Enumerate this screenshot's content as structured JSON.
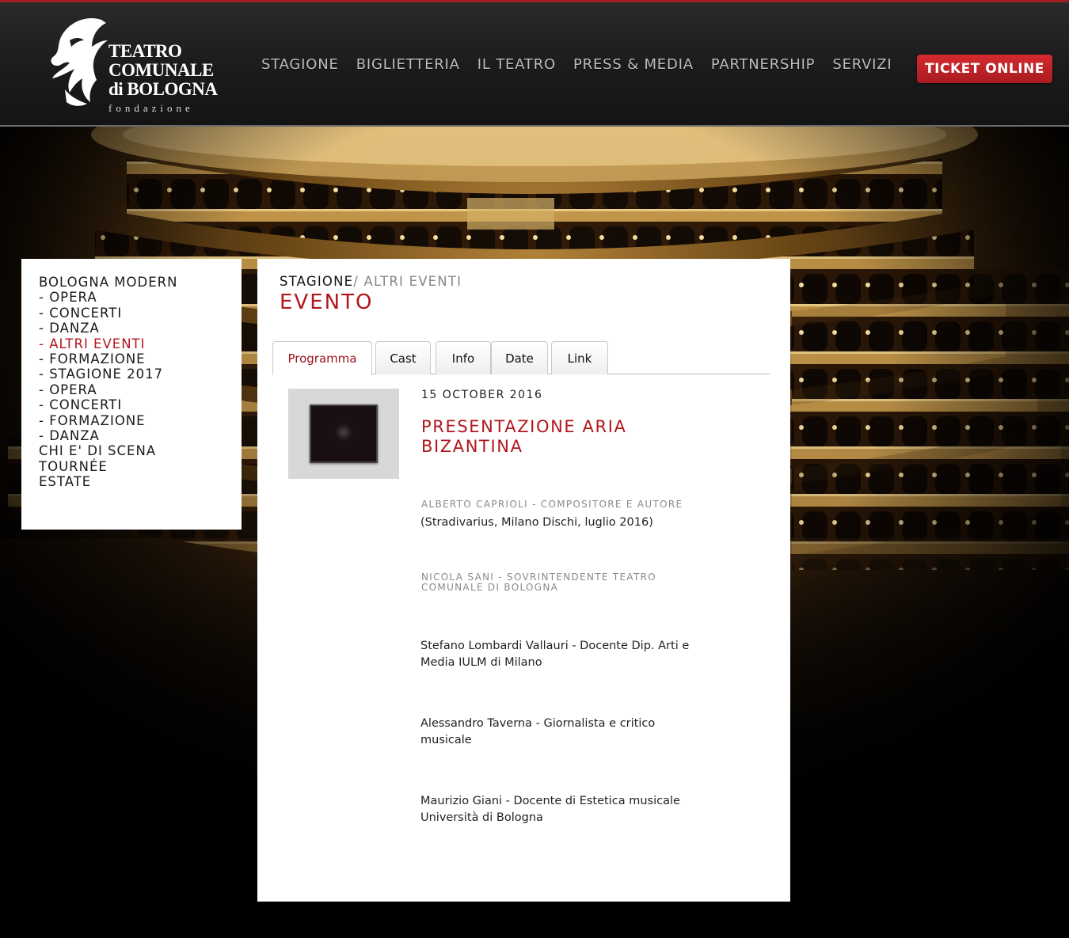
{
  "header": {
    "logo": {
      "line1": "TEATRO",
      "line2": "COMUNALE",
      "line3": "di BOLOGNA",
      "subtitle": "fondazione"
    },
    "nav": [
      "STAGIONE",
      "BIGLIETTERIA",
      "IL TEATRO",
      "PRESS & MEDIA",
      "PARTNERSHIP",
      "SERVIZI"
    ],
    "ticket_button": "TICKET ONLINE"
  },
  "sidebar": {
    "items": [
      {
        "label": "BOLOGNA MODERN",
        "active": false
      },
      {
        "label": "- OPERA",
        "active": false
      },
      {
        "label": "- CONCERTI",
        "active": false
      },
      {
        "label": "- DANZA",
        "active": false
      },
      {
        "label": "- ALTRI EVENTI",
        "active": true
      },
      {
        "label": "- FORMAZIONE",
        "active": false
      },
      {
        "label": "- STAGIONE 2017",
        "active": false
      },
      {
        "label": "- OPERA",
        "active": false
      },
      {
        "label": "- CONCERTI",
        "active": false
      },
      {
        "label": "- FORMAZIONE",
        "active": false
      },
      {
        "label": "- DANZA",
        "active": false
      },
      {
        "label": "CHI E' DI SCENA",
        "active": false
      },
      {
        "label": "TOURNÉE",
        "active": false
      },
      {
        "label": "ESTATE",
        "active": false
      }
    ]
  },
  "main": {
    "breadcrumb": {
      "section": "STAGIONE",
      "separator": "/ ",
      "current": "ALTRI EVENTI"
    },
    "title": "EVENTO",
    "tabs": [
      {
        "label": "Programma",
        "active": true
      },
      {
        "label": "Cast",
        "active": false
      },
      {
        "label": "Info",
        "active": false
      },
      {
        "label": "Date",
        "active": false
      },
      {
        "label": "Link",
        "active": false
      }
    ],
    "event": {
      "date": "15 OCTOBER 2016",
      "title": "PRESENTAZIONE ARIA BIZANTINA",
      "role1": "ALBERTO CAPRIOLI - COMPOSITORE E AUTORE",
      "note1": "(Stradivarius, Milano Dischi, luglio 2016)",
      "role2": "NICOLA SANI - SOVRINTENDENTE TEATRO COMUNALE DI BOLOGNA",
      "speaker1": "Stefano Lombardi Vallauri - Docente Dip. Arti e Media IULM di Milano",
      "speaker2": "Alessandro Taverna - Giornalista e critico musicale",
      "speaker3": "Maurizio Giani - Docente di Estetica musicale Università di Bologna"
    }
  },
  "colors": {
    "accent_red": "#b2161d",
    "ticket_red": "#c8242a",
    "header_bg": "#1e1e1e",
    "nav_text": "#bdbdbd"
  },
  "icons": {
    "logo": "griffin-logo-icon",
    "thumbnail": "album-cover-image"
  }
}
